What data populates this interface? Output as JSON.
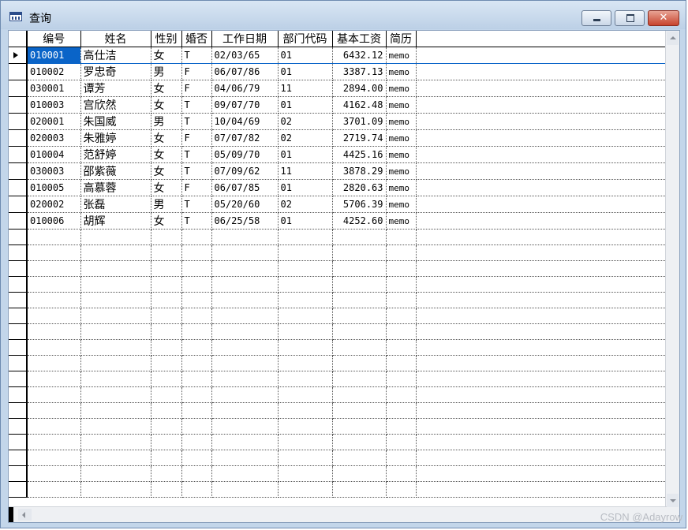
{
  "window": {
    "title": "查询",
    "watermark": "CSDN @Adayrow"
  },
  "grid": {
    "columns": [
      "编号",
      "姓名",
      "性别",
      "婚否",
      "工作日期",
      "部门代码",
      "基本工资",
      "简历"
    ],
    "current_row": 0,
    "rows": [
      [
        "010001",
        "高仕洁",
        "女",
        "T",
        "02/03/65",
        "01",
        "6432.12",
        "memo"
      ],
      [
        "010002",
        "罗忠奇",
        "男",
        "F",
        "06/07/86",
        "01",
        "3387.13",
        "memo"
      ],
      [
        "030001",
        "谭芳",
        "女",
        "F",
        "04/06/79",
        "11",
        "2894.00",
        "memo"
      ],
      [
        "010003",
        "宫欣然",
        "女",
        "T",
        "09/07/70",
        "01",
        "4162.48",
        "memo"
      ],
      [
        "020001",
        "朱国威",
        "男",
        "T",
        "10/04/69",
        "02",
        "3701.09",
        "memo"
      ],
      [
        "020003",
        "朱雅婷",
        "女",
        "F",
        "07/07/82",
        "02",
        "2719.74",
        "memo"
      ],
      [
        "010004",
        "范舒婷",
        "女",
        "T",
        "05/09/70",
        "01",
        "4425.16",
        "memo"
      ],
      [
        "030003",
        "邵紫薇",
        "女",
        "T",
        "07/09/62",
        "11",
        "3878.29",
        "memo"
      ],
      [
        "010005",
        "高慕蓉",
        "女",
        "F",
        "06/07/85",
        "01",
        "2820.63",
        "memo"
      ],
      [
        "020002",
        "张磊",
        "男",
        "T",
        "05/20/60",
        "02",
        "5706.39",
        "memo"
      ],
      [
        "010006",
        "胡辉",
        "女",
        "T",
        "06/25/58",
        "01",
        "4252.60",
        "memo"
      ]
    ]
  }
}
